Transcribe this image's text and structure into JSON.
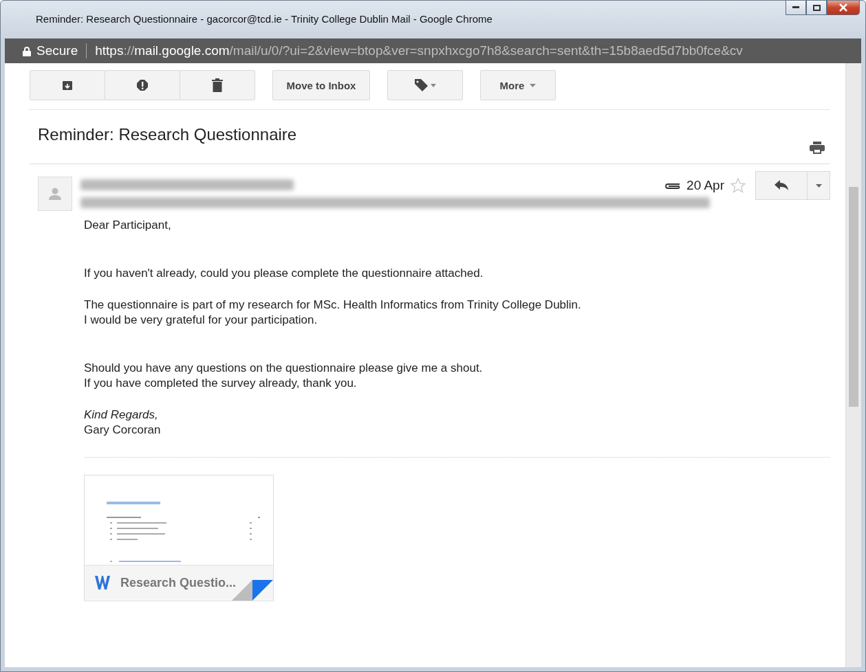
{
  "window": {
    "title": "Reminder: Research Questionnaire - gacorcor@tcd.ie - Trinity College Dublin Mail - Google Chrome"
  },
  "address_bar": {
    "security": "Secure",
    "url": [
      {
        "text": "https",
        "emphasis": true
      },
      {
        "text": "://",
        "emphasis": false
      },
      {
        "text": "mail.google.com",
        "emphasis": true
      },
      {
        "text": "/mail/u/0/?ui=2&view=btop&ver=snpxhxcgo7h8&search=sent&th=15b8aed5d7bb0fce&cv",
        "emphasis": false
      }
    ]
  },
  "toolbar": {
    "move_button": "Move to Inbox",
    "more_button": "More"
  },
  "message": {
    "subject": "Reminder: Research Questionnaire",
    "date": "20 Apr",
    "starred": false,
    "body": [
      {
        "kind": "paragraph",
        "lines": [
          {
            "text": "Dear Participant,",
            "italic": false
          }
        ]
      },
      {
        "kind": "break"
      },
      {
        "kind": "break"
      },
      {
        "kind": "paragraph",
        "lines": [
          {
            "text": "If you haven't already, could you please complete the questionnaire attached.",
            "italic": false
          }
        ]
      },
      {
        "kind": "break"
      },
      {
        "kind": "paragraph",
        "lines": [
          {
            "text": "The questionnaire is part of my research for MSc. Health Informatics from Trinity College Dublin.",
            "italic": false
          },
          {
            "text": "I would be very grateful for your participation.",
            "italic": false
          }
        ]
      },
      {
        "kind": "break"
      },
      {
        "kind": "break"
      },
      {
        "kind": "paragraph",
        "lines": [
          {
            "text": "Should you have any questions on the questionnaire please give me a shout.",
            "italic": false
          },
          {
            "text": "If you have completed the survey already, thank you.",
            "italic": false
          }
        ]
      },
      {
        "kind": "break"
      },
      {
        "kind": "paragraph",
        "lines": [
          {
            "text": "Kind Regards,",
            "italic": true
          },
          {
            "text": "Gary Corcoran",
            "italic": false
          }
        ]
      }
    ],
    "attachment": {
      "name": "Research Questio..."
    }
  }
}
